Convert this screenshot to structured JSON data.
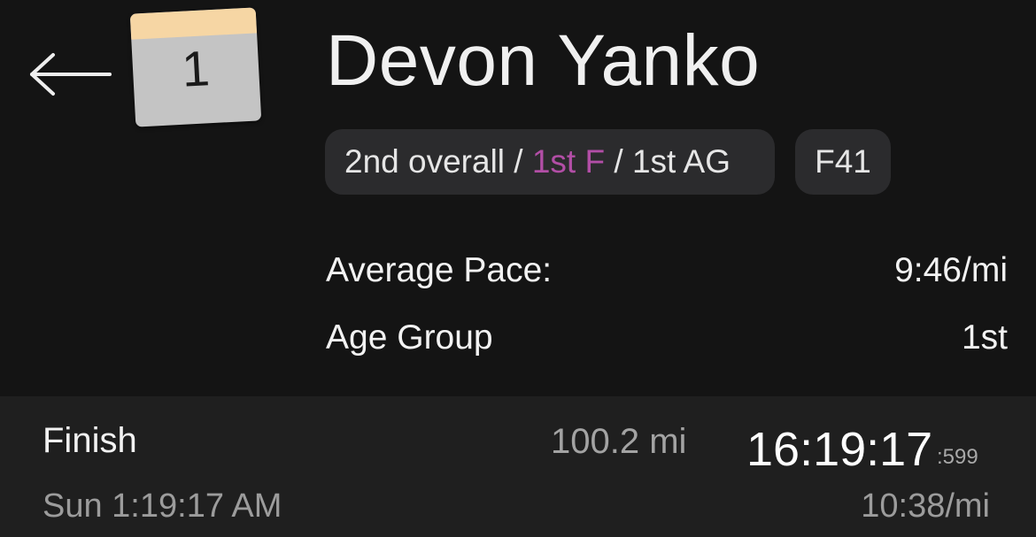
{
  "header": {
    "back_icon": "left-arrow-icon",
    "bib_number": "1",
    "runner_name": "Devon Yanko"
  },
  "placement": {
    "overall": "2nd overall",
    "separator_1": " / ",
    "gender": "1st F",
    "separator_2": " / ",
    "age_group": "1st AG",
    "division": "F41"
  },
  "stats": [
    {
      "label": "Average Pace:",
      "value": "9:46/mi"
    },
    {
      "label": "Age Group",
      "value": "1st"
    }
  ],
  "split": {
    "label": "Finish",
    "time_of_day": "Sun 1:19:17 AM",
    "distance": "100.2 mi",
    "elapsed": "16:19:17",
    "elapsed_ms": ":599",
    "pace": "10:38/mi"
  },
  "colors": {
    "background": "#141414",
    "panel": "#1f1f1f",
    "pill": "#2b2b2d",
    "accent": "#b24ea6",
    "bib_top": "#f6d6a4",
    "bib_body": "#c4c4c4"
  }
}
